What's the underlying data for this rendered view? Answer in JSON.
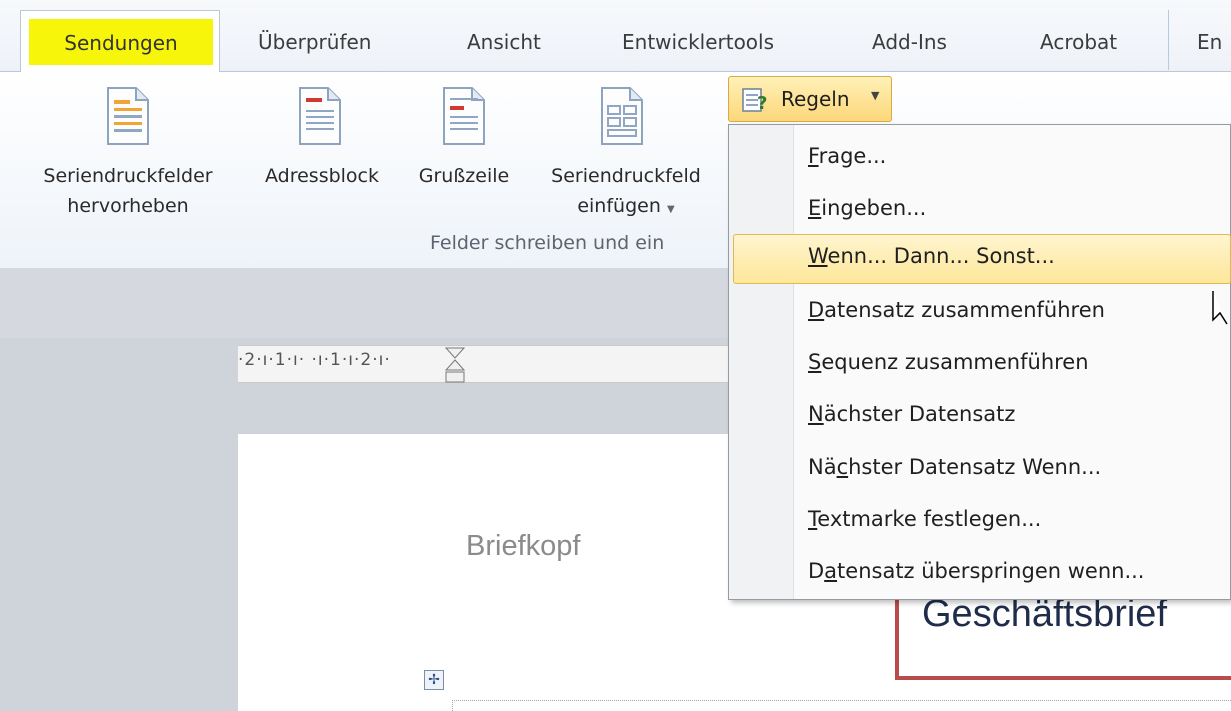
{
  "tabs": [
    {
      "label": "Sendungen",
      "active": true,
      "highlight_color": "#f6f50a"
    },
    {
      "label": "Überprüfen"
    },
    {
      "label": "Ansicht"
    },
    {
      "label": "Entwicklertools"
    },
    {
      "label": "Add-Ins"
    },
    {
      "label": "Acrobat"
    },
    {
      "label": "En"
    }
  ],
  "ribbon": {
    "buttons": [
      {
        "line1": "Seriendruckfelder",
        "line2": "hervorheben",
        "icon": "highlight-fields-icon"
      },
      {
        "line1": "Adressblock",
        "line2": "",
        "icon": "address-block-icon"
      },
      {
        "line1": "Grußzeile",
        "line2": "",
        "icon": "greeting-line-icon"
      },
      {
        "line1": "Seriendruckfeld",
        "line2": "einfügen",
        "icon": "insert-merge-field-icon"
      }
    ],
    "group_label": "Felder schreiben und ein",
    "rules_button": {
      "label": "Regeln",
      "icon": "rules-icon"
    }
  },
  "menu": {
    "items": [
      {
        "pre": "",
        "acc": "F",
        "post": "rage..."
      },
      {
        "pre": "",
        "acc": "E",
        "post": "ingeben..."
      },
      {
        "pre": "",
        "acc": "W",
        "post": "enn... Dann... Sonst...",
        "hovered": true
      },
      {
        "pre": "",
        "acc": "D",
        "post": "atensatz zusammenführen"
      },
      {
        "pre": "",
        "acc": "S",
        "post": "equenz zusammenführen"
      },
      {
        "pre": "",
        "acc": "N",
        "post": "ächster Datensatz"
      },
      {
        "pre": "Nä",
        "acc": "c",
        "post": "hster Datensatz Wenn..."
      },
      {
        "pre": "",
        "acc": "T",
        "post": "extmarke festlegen..."
      },
      {
        "pre": "D",
        "acc": "a",
        "post": "tensatz überspringen wenn..."
      }
    ]
  },
  "document": {
    "ruler": "·2·ı·1·ı·  ·ı·1·ı·2·ı·",
    "header_placeholder": "Briefkopf",
    "title": "Geschäftsbrief"
  },
  "colors": {
    "accent_border": "#b84b4b",
    "menu_hover": "#fde79a"
  }
}
